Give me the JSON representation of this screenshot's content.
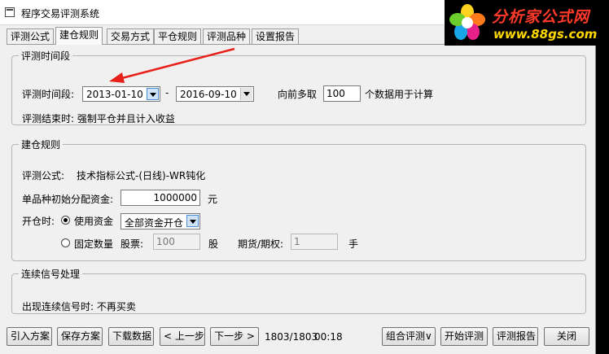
{
  "window": {
    "title": "程序交易评测系统"
  },
  "logo": {
    "cn": "分析家公式网",
    "url": "www.88gs.com"
  },
  "tabs": [
    {
      "label": "评测公式"
    },
    {
      "label": "建仓规则"
    },
    {
      "label": "交易方式"
    },
    {
      "label": "平仓规则"
    },
    {
      "label": "评测品种"
    },
    {
      "label": "设置报告"
    }
  ],
  "period": {
    "group_title": "评测时间段",
    "label": "评测时间段:",
    "start": "2013-01-10",
    "dash": "-",
    "end": "2016-09-10",
    "lookback_label": "向前多取",
    "lookback_value": "100",
    "lookback_suffix": "个数据用于计算",
    "end_note": "评测结束时: 强制平仓并且计入收益"
  },
  "build": {
    "group_title": "建仓规则",
    "formula_label": "评测公式:",
    "formula_value": "技术指标公式-(日线)-WR钝化",
    "capital_label": "单品种初始分配资金:",
    "capital_value": "1000000",
    "capital_unit": "元",
    "open_label": "开仓时:",
    "use_funds_label": "使用资金",
    "use_funds_option": "全部资金开仓",
    "fixed_qty_label": "固定数量",
    "stock_label": "股票:",
    "stock_value": "100",
    "stock_unit": "股",
    "futures_label": "期货/期权:",
    "futures_value": "1",
    "futures_unit": "手"
  },
  "signal": {
    "group_title": "连续信号处理",
    "text": "出现连续信号时: 不再买卖"
  },
  "buttons": {
    "import": "引入方案",
    "save": "保存方案",
    "download": "下载数据",
    "prev": "< 上一步",
    "next": "下一步 >",
    "progress": "1803/1803",
    "time": "00:18",
    "combo": "组合评测∨",
    "start": "开始评测",
    "report": "评测报告",
    "close": "关闭"
  }
}
